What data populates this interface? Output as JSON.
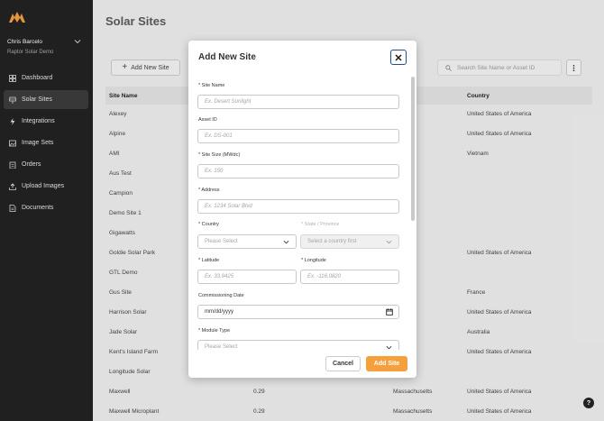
{
  "user": {
    "name": "Chris Barcelo",
    "org": "Raptor Solar Demo"
  },
  "nav": [
    {
      "label": "Dashboard",
      "icon": "dashboard-icon"
    },
    {
      "label": "Solar Sites",
      "icon": "solar-panel-icon",
      "active": true
    },
    {
      "label": "Integrations",
      "icon": "lightning-icon"
    },
    {
      "label": "Image Sets",
      "icon": "image-icon"
    },
    {
      "label": "Orders",
      "icon": "clipboard-icon"
    },
    {
      "label": "Upload Images",
      "icon": "upload-icon"
    },
    {
      "label": "Documents",
      "icon": "document-icon"
    }
  ],
  "page": {
    "title": "Solar Sites",
    "add_site_label": "Add New Site",
    "search_placeholder": "Search Site Name or Asset ID"
  },
  "table": {
    "headers": [
      "Site Name",
      "Country"
    ],
    "rows": [
      {
        "name": "Alexey",
        "size": "",
        "state": "n",
        "country": "United States of America"
      },
      {
        "name": "Alpine",
        "size": "",
        "state": "",
        "country": "United States of America"
      },
      {
        "name": "AMI",
        "size": "",
        "state": "a",
        "country": "Vietnam"
      },
      {
        "name": "Aus Test",
        "size": "",
        "state": "",
        "country": ""
      },
      {
        "name": "Campion",
        "size": "",
        "state": "",
        "country": ""
      },
      {
        "name": "Demo Site 1",
        "size": "",
        "state": "",
        "country": ""
      },
      {
        "name": "Gigawatts",
        "size": "",
        "state": "",
        "country": ""
      },
      {
        "name": "Goldie Solar Park",
        "size": "",
        "state": "rolina",
        "country": "United States of America"
      },
      {
        "name": "GTL Demo",
        "size": "",
        "state": "",
        "country": ""
      },
      {
        "name": "Gus Site",
        "size": "",
        "state": "",
        "country": "France"
      },
      {
        "name": "Harrison Solar",
        "size": "",
        "state": "",
        "country": "United States of America"
      },
      {
        "name": "Jade Solar",
        "size": "",
        "state": "th Wales",
        "country": "Australia"
      },
      {
        "name": "Kent's Island Farm",
        "size": "",
        "state": "husetts",
        "country": "United States of America"
      },
      {
        "name": "Longitude Solar",
        "size": "",
        "state": "",
        "country": ""
      },
      {
        "name": "Maxwell",
        "size": "0.29",
        "state": "Massachusetts",
        "country": "United States of America"
      },
      {
        "name": "Maxwell Microplant",
        "size": "0.29",
        "state": "Massachusetts",
        "country": "United States of America"
      }
    ]
  },
  "modal": {
    "title": "Add New Site",
    "site_name_label": "* Site Name",
    "site_name_placeholder": "Ex. Desert Sunlight",
    "asset_id_label": "Asset ID",
    "asset_id_placeholder": "Ex. DS-001",
    "site_size_label": "* Site Size (MWdc)",
    "site_size_placeholder": "Ex. 150",
    "address_label": "* Address",
    "address_placeholder": "Ex. 1234 Solar Blvd",
    "country_label": "* Country",
    "country_value": "Please Select",
    "state_label": "* State / Province",
    "state_value": "Select a country first",
    "latitude_label": "* Latitude",
    "latitude_placeholder": "Ex. 33.9425",
    "longitude_label": "* Longitude",
    "longitude_placeholder": "Ex. -116.0820",
    "commissioning_label": "Commissioning Date",
    "commissioning_value": "mm/dd/yyyy",
    "module_type_label": "* Module Type",
    "module_type_value": "Please Select",
    "cancel_label": "Cancel",
    "add_label": "Add Site"
  },
  "help_label": "?"
}
